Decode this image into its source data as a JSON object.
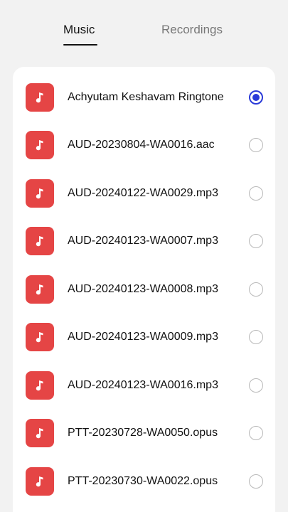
{
  "tabs": {
    "music_label": "Music",
    "recordings_label": "Recordings",
    "active": "Music"
  },
  "colors": {
    "accent": "#2a3ad8",
    "icon_tile": "#e54545"
  },
  "files": [
    {
      "name": "Achyutam Keshavam Ringtone",
      "selected": true,
      "icon": "music-note-icon"
    },
    {
      "name": "AUD-20230804-WA0016.aac",
      "selected": false,
      "icon": "music-note-icon"
    },
    {
      "name": "AUD-20240122-WA0029.mp3",
      "selected": false,
      "icon": "music-note-icon"
    },
    {
      "name": "AUD-20240123-WA0007.mp3",
      "selected": false,
      "icon": "music-note-icon"
    },
    {
      "name": "AUD-20240123-WA0008.mp3",
      "selected": false,
      "icon": "music-note-icon"
    },
    {
      "name": "AUD-20240123-WA0009.mp3",
      "selected": false,
      "icon": "music-note-icon"
    },
    {
      "name": "AUD-20240123-WA0016.mp3",
      "selected": false,
      "icon": "music-note-icon"
    },
    {
      "name": "PTT-20230728-WA0050.opus",
      "selected": false,
      "icon": "music-note-icon"
    },
    {
      "name": "PTT-20230730-WA0022.opus",
      "selected": false,
      "icon": "music-note-icon"
    }
  ]
}
